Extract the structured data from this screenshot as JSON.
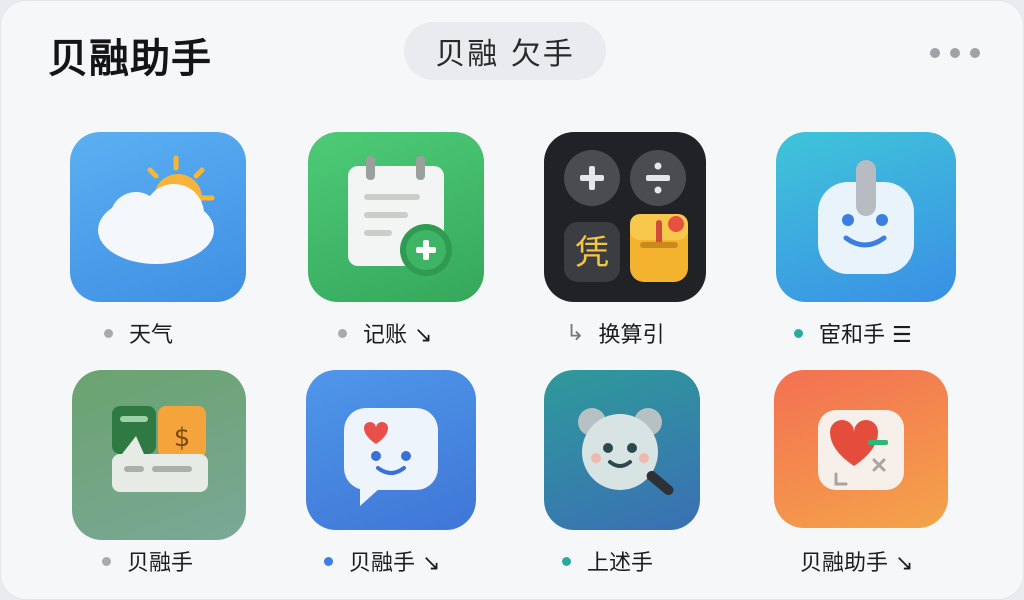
{
  "header": {
    "title": "贝融助手",
    "center_pill": "贝融 欠手",
    "more_label": "•••"
  },
  "apps": [
    {
      "label": "天气",
      "dot_color": "#a8aaae",
      "icon": "weather-icon"
    },
    {
      "label": "记账 ↘",
      "dot_color": "#a8aaae",
      "icon": "notepad-icon"
    },
    {
      "label": "换算引",
      "prefix": "↳",
      "dot_color": "",
      "icon": "calculator-icon"
    },
    {
      "label": "宦和手 ☰",
      "dot_color": "#2aa9a1",
      "icon": "assistant-icon"
    },
    {
      "label": "贝融手",
      "dot_color": "#a8aaae",
      "icon": "wallet-icon"
    },
    {
      "label": "贝融手 ↘",
      "dot_color": "#3e7de6",
      "icon": "chat-icon"
    },
    {
      "label": "上述手",
      "dot_color": "#2aa9a1",
      "icon": "search-icon"
    },
    {
      "label": "贝融助手 ↘",
      "dot_color": "",
      "icon": "health-icon"
    }
  ],
  "colors": {
    "weather_tile": "#4fa3ee",
    "notes_tile": "#45c06b",
    "calc_tile": "#202226",
    "assistant_tile": "#37b8de",
    "wallet_tile": "#6ea67e",
    "chat_tile": "#4c8fe6",
    "search_tile": "#2b8e95",
    "health_tile": "#f0855a"
  },
  "icon_text": {
    "calc_symbol": "凭",
    "wallet_symbol": "$"
  }
}
